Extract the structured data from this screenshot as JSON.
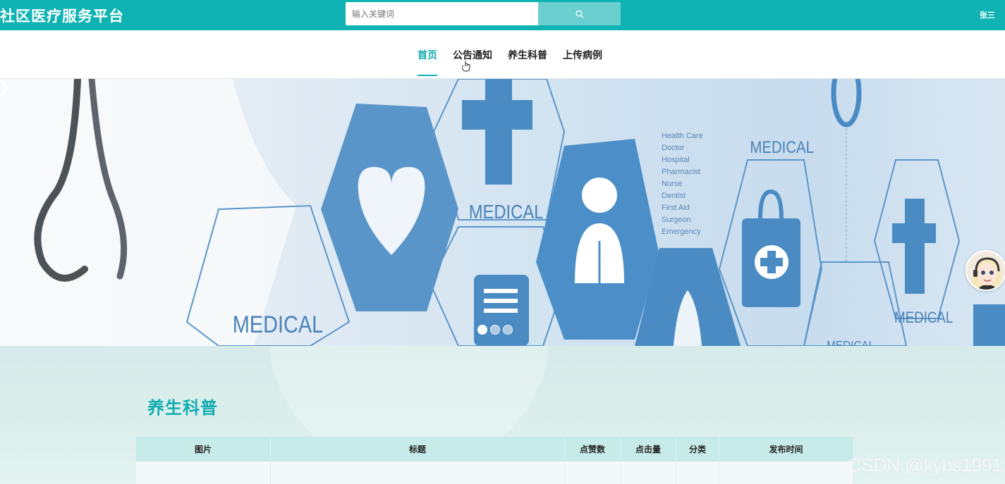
{
  "header": {
    "brand": "社区医疗服务平台",
    "search_placeholder": "输入关键词",
    "search_icon": "search-icon",
    "user_name": "张三"
  },
  "nav": {
    "items": [
      {
        "label": "首页",
        "active": true
      },
      {
        "label": "公告通知",
        "active": false
      },
      {
        "label": "养生科普",
        "active": false
      },
      {
        "label": "上传病例",
        "active": false
      }
    ]
  },
  "banner": {
    "hex_labels": [
      "MEDICAL",
      "MEDICAL",
      "MEDICAL",
      "MEDICAL",
      "MEDICAL"
    ],
    "word_list": [
      "Health Care",
      "Doctor",
      "Hospital",
      "Pharmacist",
      "Nurse",
      "Dentist",
      "First Aid",
      "Surgeon",
      "Emergency"
    ],
    "slide_count": 3,
    "active_slide": 1
  },
  "section": {
    "title": "养生科普",
    "table_headers": [
      "图片",
      "标题",
      "点赞数",
      "点击量",
      "分类",
      "发布时间"
    ]
  },
  "watermark": "CSDN @kybs1991",
  "colors": {
    "primary": "#0fb3b3",
    "accent": "#12acb0",
    "search_button": "#6ccfcf",
    "table_header": "#c6ebe8"
  }
}
